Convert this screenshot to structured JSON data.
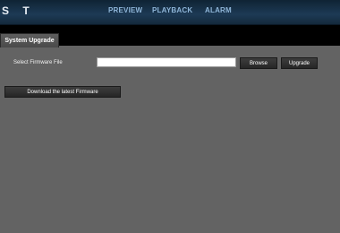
{
  "header": {
    "brand": "S T",
    "nav": {
      "preview": "PREVIEW",
      "playback": "PLAYBACK",
      "alarm": "ALARM"
    }
  },
  "tabs": {
    "active": "System Upgrade"
  },
  "upgrade": {
    "label": "Select Firmware File",
    "file_value": "",
    "browse": "Browse",
    "upgrade": "Upgrade",
    "download": "Download the latest Firmware"
  }
}
